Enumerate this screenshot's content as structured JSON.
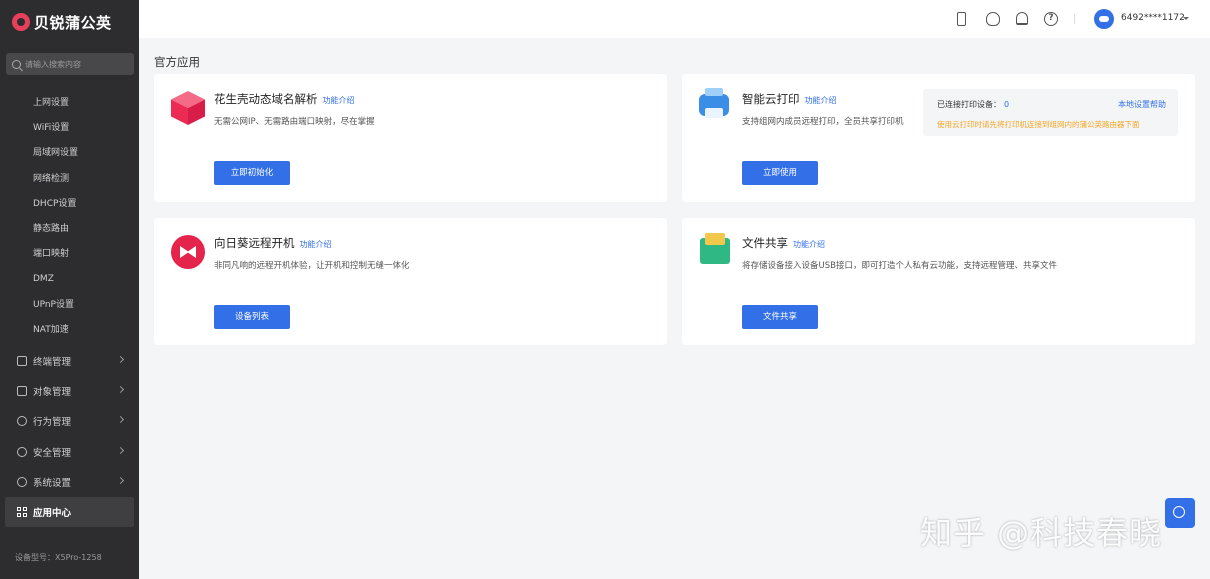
{
  "brand": {
    "name": "贝锐蒲公英"
  },
  "search": {
    "placeholder": "请输入搜索内容"
  },
  "sidebar": {
    "subitems": [
      "上网设置",
      "WiFi设置",
      "局域网设置",
      "网络检测",
      "DHCP设置",
      "静态路由",
      "端口映射",
      "DMZ",
      "UPnP设置",
      "NAT加速"
    ],
    "items": [
      {
        "label": "终端管理",
        "icon": "terminal-icon"
      },
      {
        "label": "对象管理",
        "icon": "object-icon"
      },
      {
        "label": "行为管理",
        "icon": "behavior-icon"
      },
      {
        "label": "安全管理",
        "icon": "shield-icon"
      },
      {
        "label": "系统设置",
        "icon": "gear-icon"
      },
      {
        "label": "应用中心",
        "icon": "grid-icon"
      }
    ],
    "device_model": "设备型号：X5Pro-1258"
  },
  "header": {
    "username": "6492****1172"
  },
  "section": {
    "title": "官方应用"
  },
  "apps": [
    {
      "title": "花生壳动态域名解析",
      "link": "功能介绍",
      "desc": "无需公网IP、无需路由端口映射，尽在掌握",
      "button": "立即初始化",
      "icon": "cube-icon"
    },
    {
      "title": "智能云打印",
      "link": "功能介绍",
      "desc": "支持组网内成员远程打印，全员共享打印机",
      "button": "立即使用",
      "icon": "printer-icon"
    },
    {
      "title": "向日葵远程开机",
      "link": "功能介绍",
      "desc": "非同凡响的远程开机体验，让开机和控制无缝一体化",
      "button": "设备列表",
      "icon": "sunflower-icon"
    },
    {
      "title": "文件共享",
      "link": "功能介绍",
      "desc": "将存储设备接入设备USB接口，即可打造个人私有云功能，支持远程管理、共享文件",
      "button": "文件共享",
      "icon": "folder-icon"
    }
  ],
  "print_info": {
    "status_label": "已连接打印设备：",
    "count": "0",
    "help": "本地设置帮助",
    "warning": "使用云打印时请先将打印机连接到组网内的蒲公英路由器下面"
  },
  "watermark": "知乎 @科技春晓",
  "colors": {
    "accent": "#3370e8",
    "sidebar": "#2d2d2f",
    "warning": "#f5a623"
  }
}
